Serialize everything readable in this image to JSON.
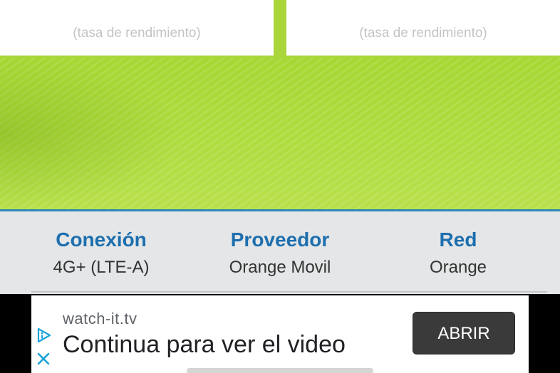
{
  "results": {
    "left_card": {
      "value": "",
      "caption": "(tasa de rendimiento)"
    },
    "right_card": {
      "value": "",
      "caption": "(tasa de rendimiento)"
    }
  },
  "info": {
    "connection": {
      "label": "Conexión",
      "value": "4G+ (LTE-A)"
    },
    "provider": {
      "label": "Proveedor",
      "value": "Orange Movil"
    },
    "network": {
      "label": "Red",
      "value": "Orange"
    }
  },
  "ad": {
    "domain": "watch-it.tv",
    "headline": "Continua para ver el video",
    "cta_label": "ABRIR",
    "icons": [
      "ad-choices-icon",
      "close-icon"
    ]
  },
  "colors": {
    "accent_green": "#a9d63a",
    "label_blue": "#1d6fae",
    "divider_blue": "#2f86b8",
    "info_bg": "#e4e6e7",
    "cta_bg": "#3a3a3a"
  }
}
